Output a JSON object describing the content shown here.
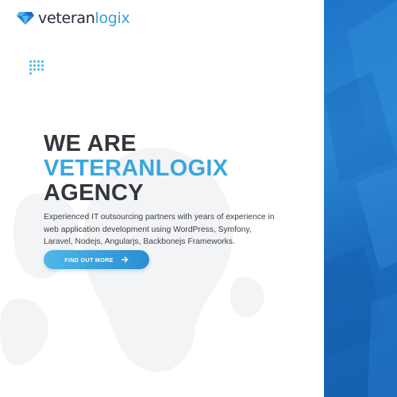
{
  "brand": {
    "name_part1": "veteran",
    "name_part2": "logix",
    "logo_icon": "diamond-icon"
  },
  "hero": {
    "headline_line1": "WE ARE",
    "headline_line2": "VETERANLOGIX",
    "headline_line3": "AGENCY",
    "description": "Experienced IT outsourcing partners with years of experience in web application development using WordPress, Symfony, Laravel, Nodejs, Angularjs, Backbonejs Frameworks.",
    "cta_label": "FIND OUT MORE",
    "cta_icon": "arrow-right-icon"
  },
  "decor": {
    "dots_icon": "dots-grid-icon"
  },
  "colors": {
    "accent": "#3aa6dd",
    "heading": "#33363d",
    "panel_blue": "#1f74c7"
  }
}
